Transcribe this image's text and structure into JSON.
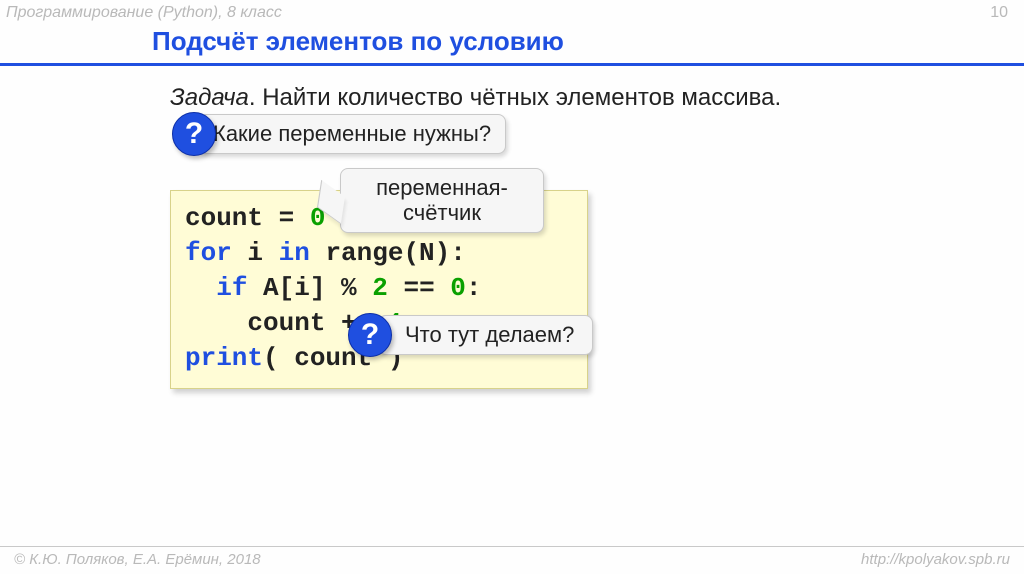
{
  "header": {
    "course": "Программирование (Python), 8 класс",
    "page": "10"
  },
  "title": "Подсчёт элементов по условию",
  "task": {
    "label": "Задача",
    "text": ". Найти количество чётных элементов массива."
  },
  "callouts": {
    "q1": {
      "badge": "?",
      "text": "Какие переменные нужны?"
    },
    "counter": {
      "line1": "переменная-",
      "line2": "счётчик"
    },
    "q2": {
      "badge": "?",
      "text": "Что тут делаем?"
    }
  },
  "code": {
    "l1a": "count = ",
    "l1b": "0",
    "l2a": "for",
    "l2b": " i ",
    "l2c": "in",
    "l2d": " range(N):",
    "l3a": "  ",
    "l3b": "if",
    "l3c": " A[i] % ",
    "l3d": "2",
    "l3e": " == ",
    "l3f": "0",
    "l3g": ":",
    "l4": "    count += ",
    "l4b": "1",
    "l5a": "print",
    "l5b": "( count )"
  },
  "footer": {
    "copyright": "© К.Ю. Поляков, Е.А. Ерёмин, 2018",
    "url": "http://kpolyakov.spb.ru"
  }
}
